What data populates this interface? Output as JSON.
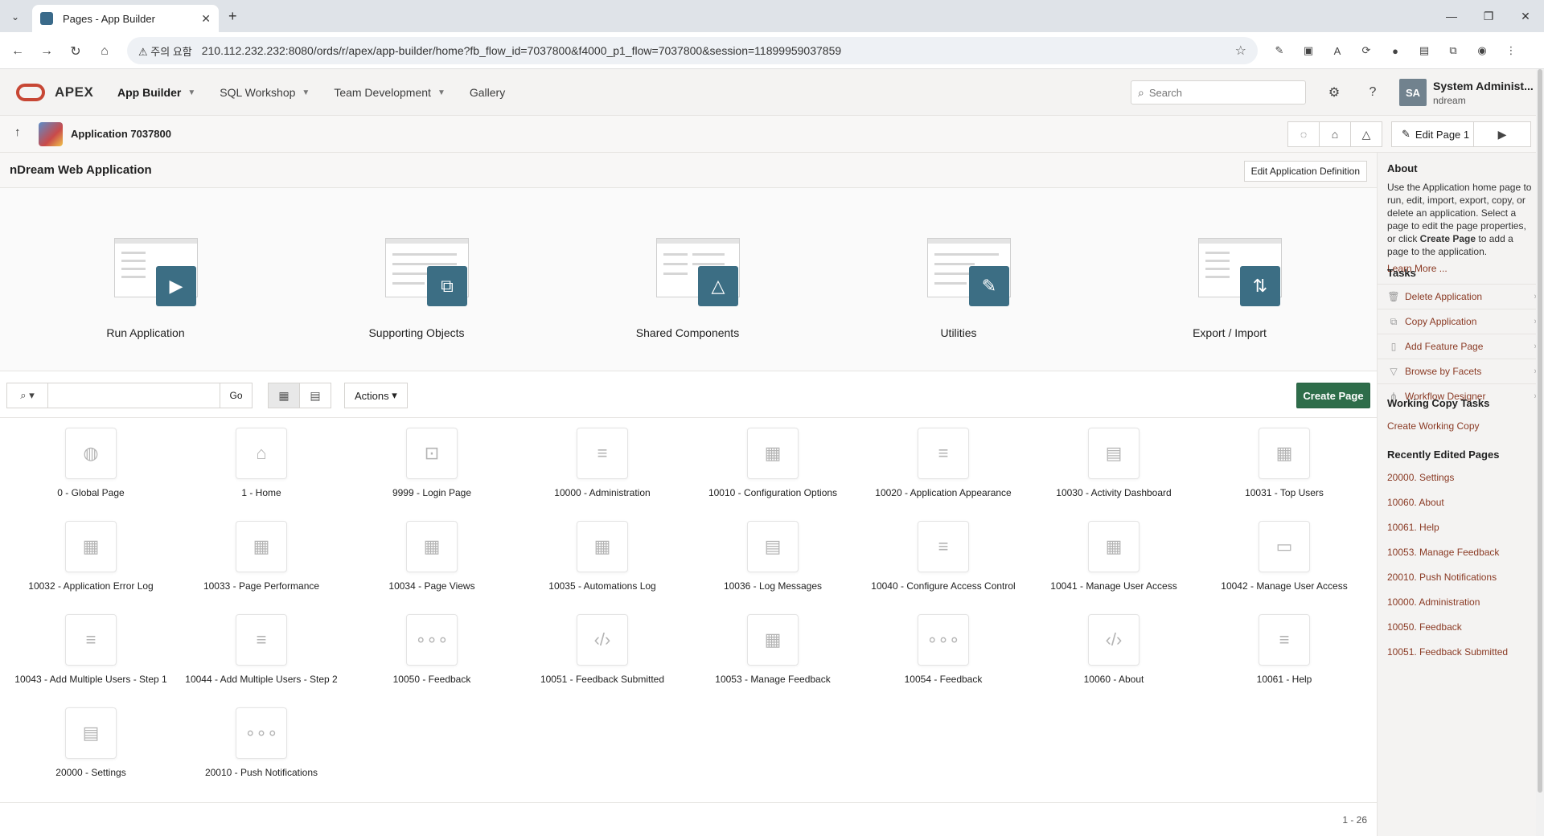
{
  "browser": {
    "tab_title": "Pages - App Builder",
    "security_label": "주의 요함",
    "url": "210.112.232.232:8080/ords/r/apex/app-builder/home?fb_flow_id=7037800&f4000_p1_flow=7037800&session=11899959037859"
  },
  "header": {
    "logo": "APEX",
    "nav": [
      {
        "label": "App Builder"
      },
      {
        "label": "SQL Workshop"
      },
      {
        "label": "Team Development"
      },
      {
        "label": "Gallery"
      }
    ],
    "search_placeholder": "Search",
    "user_initials": "SA",
    "user_name": "System Administ...",
    "user_workspace": "ndream"
  },
  "appbar": {
    "title": "Application 7037800",
    "edit_page": "Edit Page 1"
  },
  "region": {
    "title": "nDream Web Application",
    "edit_def": "Edit Application Definition"
  },
  "tiles": [
    {
      "label": "Run Application",
      "icon": "play-icon"
    },
    {
      "label": "Supporting Objects",
      "icon": "objects-icon"
    },
    {
      "label": "Shared Components",
      "icon": "shapes-icon"
    },
    {
      "label": "Utilities",
      "icon": "wrench-icon"
    },
    {
      "label": "Export / Import",
      "icon": "transfer-icon"
    }
  ],
  "toolbar": {
    "go": "Go",
    "actions": "Actions",
    "create_page": "Create Page"
  },
  "pages": [
    {
      "label": "0 - Global Page",
      "icon": "globe-icon"
    },
    {
      "label": "1 - Home",
      "icon": "home-icon"
    },
    {
      "label": "9999 - Login Page",
      "icon": "lock-icon"
    },
    {
      "label": "10000 - Administration",
      "icon": "list-icon"
    },
    {
      "label": "10010 - Configuration Options",
      "icon": "grid-form-icon"
    },
    {
      "label": "10020 - Application Appearance",
      "icon": "list-icon"
    },
    {
      "label": "10030 - Activity Dashboard",
      "icon": "table-icon"
    },
    {
      "label": "10031 - Top Users",
      "icon": "grid-form-icon"
    },
    {
      "label": "10032 - Application Error Log",
      "icon": "grid-form-icon"
    },
    {
      "label": "10033 - Page Performance",
      "icon": "grid-form-icon"
    },
    {
      "label": "10034 - Page Views",
      "icon": "grid-form-icon"
    },
    {
      "label": "10035 - Automations Log",
      "icon": "grid-form-icon"
    },
    {
      "label": "10036 - Log Messages",
      "icon": "table-icon"
    },
    {
      "label": "10040 - Configure Access Control",
      "icon": "list-icon"
    },
    {
      "label": "10041 - Manage User Access",
      "icon": "grid-form-icon"
    },
    {
      "label": "10042 - Manage User Access",
      "icon": "form-icon"
    },
    {
      "label": "10043 - Add Multiple Users - Step 1",
      "icon": "list-icon"
    },
    {
      "label": "10044 - Add Multiple Users - Step 2",
      "icon": "list-icon"
    },
    {
      "label": "10050 - Feedback",
      "icon": "dots-icon"
    },
    {
      "label": "10051 - Feedback Submitted",
      "icon": "code-icon"
    },
    {
      "label": "10053 - Manage Feedback",
      "icon": "grid-form-icon"
    },
    {
      "label": "10054 - Feedback",
      "icon": "dots-icon"
    },
    {
      "label": "10060 - About",
      "icon": "code-icon"
    },
    {
      "label": "10061 - Help",
      "icon": "list-icon"
    },
    {
      "label": "20000 - Settings",
      "icon": "settings-page-icon"
    },
    {
      "label": "20010 - Push Notifications",
      "icon": "dots-icon"
    }
  ],
  "pagination": "1 - 26",
  "sidebar": {
    "about_heading": "About",
    "about_text_1": "Use the Application home page to run, edit, import, export, copy, or delete an application. Select a page to edit the page properties, or click ",
    "about_text_bold": "Create Page",
    "about_text_2": " to add a page to the application.",
    "learn_more": "Learn More ...",
    "tasks_heading": "Tasks",
    "tasks": [
      {
        "label": "Delete Application",
        "icon": "trash-icon"
      },
      {
        "label": "Copy Application",
        "icon": "copy-icon"
      },
      {
        "label": "Add Feature Page",
        "icon": "page-icon"
      },
      {
        "label": "Browse by Facets",
        "icon": "filter-icon"
      },
      {
        "label": "Workflow Designer",
        "icon": "workflow-icon"
      }
    ],
    "working_copy_heading": "Working Copy Tasks",
    "working_copy_link": "Create Working Copy",
    "recent_heading": "Recently Edited Pages",
    "recent": [
      "20000. Settings",
      "10060. About",
      "10061. Help",
      "10053. Manage Feedback",
      "20010. Push Notifications",
      "10000. Administration",
      "10050. Feedback",
      "10051. Feedback Submitted"
    ]
  }
}
